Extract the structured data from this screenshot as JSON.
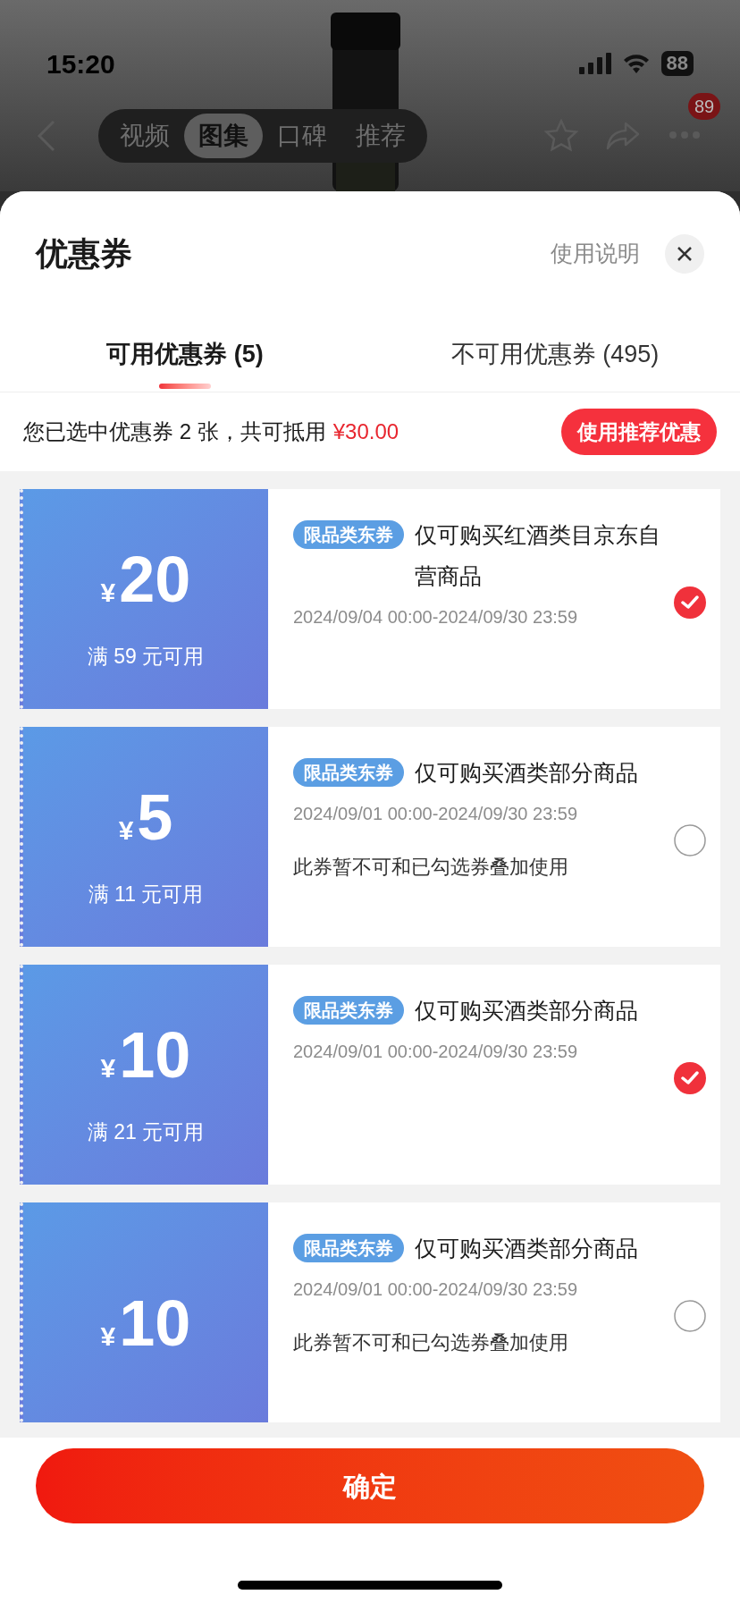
{
  "status_bar": {
    "time": "15:20",
    "battery": "88"
  },
  "nav": {
    "tabs": [
      {
        "label": "视频",
        "selected": false
      },
      {
        "label": "图集",
        "selected": true
      },
      {
        "label": "口碑",
        "selected": false
      },
      {
        "label": "推荐",
        "selected": false
      }
    ],
    "badge": "89"
  },
  "sheet": {
    "title": "优惠券",
    "help_link": "使用说明",
    "tabs": [
      {
        "label": "可用优惠券 (5)",
        "selected": true
      },
      {
        "label": "不可用优惠券 (495)",
        "selected": false
      }
    ],
    "summary": {
      "text": "您已选中优惠券 2 张，共可抵用",
      "amount": "¥30.00",
      "button": "使用推荐优惠"
    },
    "coupons": [
      {
        "currency": "¥",
        "amount": "20",
        "condition": "满 59 元可用",
        "tag": "限品类东券",
        "description": "仅可购买红酒类目京东自营商品",
        "validity": "2024/09/04 00:00-2024/09/30 23:59",
        "selected": true
      },
      {
        "currency": "¥",
        "amount": "5",
        "condition": "满 11 元可用",
        "tag": "限品类东券",
        "description": "仅可购买酒类部分商品",
        "validity": "2024/09/01 00:00-2024/09/30 23:59",
        "note": "此券暂不可和已勾选券叠加使用",
        "selected": false
      },
      {
        "currency": "¥",
        "amount": "10",
        "condition": "满 21 元可用",
        "tag": "限品类东券",
        "description": "仅可购买酒类部分商品",
        "validity": "2024/09/01 00:00-2024/09/30 23:59",
        "selected": true
      },
      {
        "currency": "¥",
        "amount": "10",
        "tag": "限品类东券",
        "description": "仅可购买酒类部分商品",
        "validity": "2024/09/01 00:00-2024/09/30 23:59",
        "note": "此券暂不可和已勾选券叠加使用",
        "selected": false
      }
    ],
    "confirm": "确定"
  }
}
